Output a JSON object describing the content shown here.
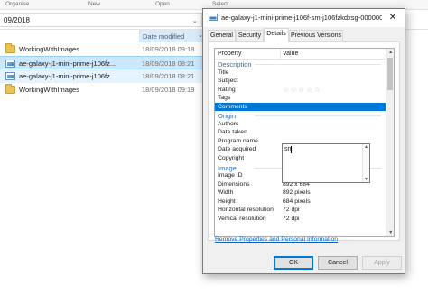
{
  "explorer": {
    "ribbon_labels": [
      "Organise",
      "New",
      "Open",
      "Select"
    ],
    "address": "09/2018",
    "column_date": "Date modified",
    "files": [
      {
        "name": "WorkingWithImages",
        "date": "18/09/2018 09:18",
        "type": "folder",
        "state": "normal"
      },
      {
        "name": "ae-galaxy-j1-mini-prime-j106fz...",
        "date": "18/09/2018 08:21",
        "type": "image",
        "state": "selected"
      },
      {
        "name": "ae-galaxy-j1-mini-prime-j106fz...",
        "date": "18/09/2018 08:21",
        "type": "image",
        "state": "hover"
      },
      {
        "name": "WorkingWithImages",
        "date": "18/09/2018 09:19",
        "type": "folder",
        "state": "normal"
      }
    ]
  },
  "dialog": {
    "title": "ae-galaxy-j1-mini-prime-j106f-sm-j106fzkdxsg-000000005-...",
    "tabs": [
      {
        "label": "General",
        "active": false
      },
      {
        "label": "Security",
        "active": false
      },
      {
        "label": "Details",
        "active": true
      },
      {
        "label": "Previous Versions",
        "active": false
      }
    ],
    "grid": {
      "col_property": "Property",
      "col_value": "Value",
      "rows": [
        {
          "section": "Description"
        },
        {
          "k": "Title",
          "v": ""
        },
        {
          "k": "Subject",
          "v": ""
        },
        {
          "k": "Rating",
          "stars": 5
        },
        {
          "k": "Tags",
          "v": ""
        },
        {
          "k": "Comments",
          "v": "",
          "editing": true
        },
        {
          "section": "Origin"
        },
        {
          "k": "Authors",
          "v": ""
        },
        {
          "k": "Date taken",
          "v": ""
        },
        {
          "k": "Program name",
          "v": ""
        },
        {
          "k": "Date acquired",
          "v": ""
        },
        {
          "k": "Copyright",
          "v": ""
        },
        {
          "section": "Image"
        },
        {
          "k": "Image ID",
          "v": ""
        },
        {
          "k": "Dimensions",
          "v": "892 x 684"
        },
        {
          "k": "Width",
          "v": "892 pixels"
        },
        {
          "k": "Height",
          "v": "684 pixels"
        },
        {
          "k": "Horizontal resolution",
          "v": "72 dpi"
        },
        {
          "k": "Vertical resolution",
          "v": "72 dpi"
        }
      ],
      "comment_text": "sn"
    },
    "remove_link": "Remove Properties and Personal Information",
    "buttons": {
      "ok": "OK",
      "cancel": "Cancel",
      "apply": "Apply"
    }
  },
  "colors": {
    "accent": "#0078d7",
    "selection": "#cce8ff",
    "section_text": "#2a6ab0",
    "link": "#0066cc"
  }
}
